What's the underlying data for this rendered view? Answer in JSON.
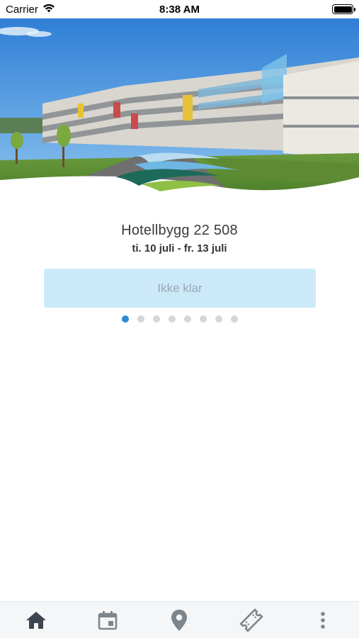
{
  "status_bar": {
    "carrier": "Carrier",
    "time": "8:38 AM",
    "wifi_icon": "wifi-icon",
    "battery_icon": "battery-icon"
  },
  "hero": {
    "image": "hotel-building-photo",
    "logo": "wave-logo"
  },
  "booking": {
    "hotel_name": "Hotellbygg 22 508",
    "dates": "ti. 10 juli - fr. 13 juli",
    "status_button_label": "Ikke klar"
  },
  "pager": {
    "total": 8,
    "active_index": 0
  },
  "tab_bar": {
    "tabs": [
      {
        "icon": "home-icon",
        "active": true
      },
      {
        "icon": "calendar-icon",
        "active": false
      },
      {
        "icon": "location-pin-icon",
        "active": false
      },
      {
        "icon": "ticket-icon",
        "active": false
      },
      {
        "icon": "more-vertical-icon",
        "active": false
      }
    ]
  },
  "colors": {
    "accent": "#2a8ad8",
    "button_bg": "#cce9fa",
    "button_text": "#9aa8b2",
    "tab_active": "#3d4650",
    "tab_inactive": "#7d858d"
  }
}
